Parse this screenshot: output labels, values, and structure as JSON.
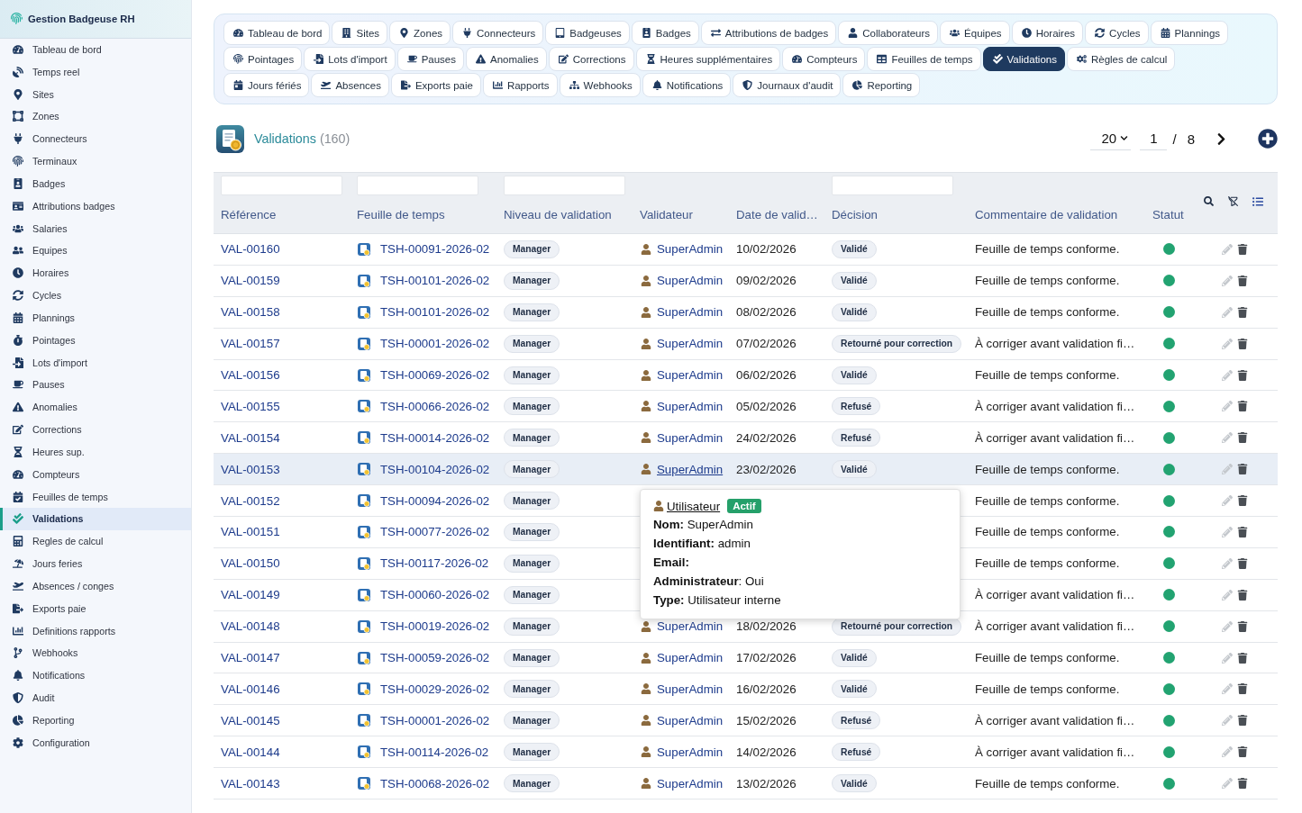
{
  "sidebar": {
    "title": "Gestion Badgeuse RH",
    "items": [
      {
        "label": "Tableau de bord",
        "selected": false
      },
      {
        "label": "Temps reel",
        "selected": false
      },
      {
        "label": "Sites",
        "selected": false
      },
      {
        "label": "Zones",
        "selected": false
      },
      {
        "label": "Connecteurs",
        "selected": false
      },
      {
        "label": "Terminaux",
        "selected": false
      },
      {
        "label": "Badges",
        "selected": false
      },
      {
        "label": "Attributions badges",
        "selected": false
      },
      {
        "label": "Salaries",
        "selected": false
      },
      {
        "label": "Equipes",
        "selected": false
      },
      {
        "label": "Horaires",
        "selected": false
      },
      {
        "label": "Cycles",
        "selected": false
      },
      {
        "label": "Plannings",
        "selected": false
      },
      {
        "label": "Pointages",
        "selected": false
      },
      {
        "label": "Lots d'import",
        "selected": false
      },
      {
        "label": "Pauses",
        "selected": false
      },
      {
        "label": "Anomalies",
        "selected": false
      },
      {
        "label": "Corrections",
        "selected": false
      },
      {
        "label": "Heures sup.",
        "selected": false
      },
      {
        "label": "Compteurs",
        "selected": false
      },
      {
        "label": "Feuilles de temps",
        "selected": false
      },
      {
        "label": "Validations",
        "selected": true
      },
      {
        "label": "Regles de calcul",
        "selected": false
      },
      {
        "label": "Jours feries",
        "selected": false
      },
      {
        "label": "Absences / conges",
        "selected": false
      },
      {
        "label": "Exports paie",
        "selected": false
      },
      {
        "label": "Definitions rapports",
        "selected": false
      },
      {
        "label": "Webhooks",
        "selected": false
      },
      {
        "label": "Notifications",
        "selected": false
      },
      {
        "label": "Audit",
        "selected": false
      },
      {
        "label": "Reporting",
        "selected": false
      },
      {
        "label": "Configuration",
        "selected": false
      }
    ]
  },
  "nav": {
    "tabs": [
      {
        "label": "Tableau de bord",
        "selected": false
      },
      {
        "label": "Sites",
        "selected": false
      },
      {
        "label": "Zones",
        "selected": false
      },
      {
        "label": "Connecteurs",
        "selected": false
      },
      {
        "label": "Badgeuses",
        "selected": false
      },
      {
        "label": "Badges",
        "selected": false
      },
      {
        "label": "Attributions de badges",
        "selected": false
      },
      {
        "label": "Collaborateurs",
        "selected": false
      },
      {
        "label": "Équipes",
        "selected": false
      },
      {
        "label": "Horaires",
        "selected": false
      },
      {
        "label": "Cycles",
        "selected": false
      },
      {
        "label": "Plannings",
        "selected": false
      },
      {
        "label": "Pointages",
        "selected": false
      },
      {
        "label": "Lots d'import",
        "selected": false
      },
      {
        "label": "Pauses",
        "selected": false
      },
      {
        "label": "Anomalies",
        "selected": false
      },
      {
        "label": "Corrections",
        "selected": false
      },
      {
        "label": "Heures supplémentaires",
        "selected": false
      },
      {
        "label": "Compteurs",
        "selected": false
      },
      {
        "label": "Feuilles de temps",
        "selected": false
      },
      {
        "label": "Validations",
        "selected": true
      },
      {
        "label": "Règles de calcul",
        "selected": false
      },
      {
        "label": "Jours fériés",
        "selected": false
      },
      {
        "label": "Absences",
        "selected": false
      },
      {
        "label": "Exports paie",
        "selected": false
      },
      {
        "label": "Rapports",
        "selected": false
      },
      {
        "label": "Webhooks",
        "selected": false
      },
      {
        "label": "Notifications",
        "selected": false
      },
      {
        "label": "Journaux d'audit",
        "selected": false
      },
      {
        "label": "Reporting",
        "selected": false
      }
    ]
  },
  "header": {
    "title": "Validations",
    "count": "(160)",
    "pagination": {
      "page_size": "20",
      "page": "1",
      "separator": "/",
      "total_pages": "8"
    }
  },
  "table": {
    "columns": [
      {
        "label": "Référence",
        "filter": true
      },
      {
        "label": "Feuille de temps",
        "filter": true
      },
      {
        "label": "Niveau de validation",
        "filter": true
      },
      {
        "label": "Validateur",
        "filter": false
      },
      {
        "label": "Date de valid…",
        "filter": false
      },
      {
        "label": "Décision",
        "filter": true
      },
      {
        "label": "Commentaire de validation",
        "filter": false
      },
      {
        "label": "Statut",
        "filter": false
      }
    ],
    "rows": [
      {
        "reference": "VAL-00160",
        "timesheet": "TSH-00091-2026-02",
        "validation_level": "Manager",
        "validator": "SuperAdmin",
        "date": "10/02/2026",
        "decision": "Validé",
        "comment": "Feuille de temps conforme.",
        "active": true,
        "highlighted": false
      },
      {
        "reference": "VAL-00159",
        "timesheet": "TSH-00101-2026-02",
        "validation_level": "Manager",
        "validator": "SuperAdmin",
        "date": "09/02/2026",
        "decision": "Validé",
        "comment": "Feuille de temps conforme.",
        "active": true,
        "highlighted": false
      },
      {
        "reference": "VAL-00158",
        "timesheet": "TSH-00101-2026-02",
        "validation_level": "Manager",
        "validator": "SuperAdmin",
        "date": "08/02/2026",
        "decision": "Validé",
        "comment": "Feuille de temps conforme.",
        "active": true,
        "highlighted": false
      },
      {
        "reference": "VAL-00157",
        "timesheet": "TSH-00001-2026-02",
        "validation_level": "Manager",
        "validator": "SuperAdmin",
        "date": "07/02/2026",
        "decision": "Retourné pour correction",
        "comment": "À corriger avant validation fi…",
        "active": true,
        "highlighted": false
      },
      {
        "reference": "VAL-00156",
        "timesheet": "TSH-00069-2026-02",
        "validation_level": "Manager",
        "validator": "SuperAdmin",
        "date": "06/02/2026",
        "decision": "Validé",
        "comment": "Feuille de temps conforme.",
        "active": true,
        "highlighted": false
      },
      {
        "reference": "VAL-00155",
        "timesheet": "TSH-00066-2026-02",
        "validation_level": "Manager",
        "validator": "SuperAdmin",
        "date": "05/02/2026",
        "decision": "Refusé",
        "comment": "À corriger avant validation fi…",
        "active": true,
        "highlighted": false
      },
      {
        "reference": "VAL-00154",
        "timesheet": "TSH-00014-2026-02",
        "validation_level": "Manager",
        "validator": "SuperAdmin",
        "date": "24/02/2026",
        "decision": "Refusé",
        "comment": "À corriger avant validation fi…",
        "active": true,
        "highlighted": false
      },
      {
        "reference": "VAL-00153",
        "timesheet": "TSH-00104-2026-02",
        "validation_level": "Manager",
        "validator": "SuperAdmin",
        "date": "23/02/2026",
        "decision": "Validé",
        "comment": "Feuille de temps conforme.",
        "active": true,
        "highlighted": true
      },
      {
        "reference": "VAL-00152",
        "timesheet": "TSH-00094-2026-02",
        "validation_level": "Manager",
        "comment": "Feuille de temps conforme.",
        "active": true,
        "highlighted": false
      },
      {
        "reference": "VAL-00151",
        "timesheet": "TSH-00077-2026-02",
        "validation_level": "Manager",
        "comment": "Feuille de temps conforme.",
        "active": true,
        "highlighted": false
      },
      {
        "reference": "VAL-00150",
        "timesheet": "TSH-00117-2026-02",
        "validation_level": "Manager",
        "comment": "Feuille de temps conforme.",
        "active": true,
        "highlighted": false
      },
      {
        "reference": "VAL-00149",
        "timesheet": "TSH-00060-2026-02",
        "validation_level": "Manager",
        "comment": "À corriger avant validation fi…",
        "active": true,
        "highlighted": false
      },
      {
        "reference": "VAL-00148",
        "timesheet": "TSH-00019-2026-02",
        "validation_level": "Manager",
        "validator": "SuperAdmin",
        "date": "18/02/2026",
        "decision": "Retourné pour correction",
        "comment": "À corriger avant validation fi…",
        "active": true,
        "highlighted": false
      },
      {
        "reference": "VAL-00147",
        "timesheet": "TSH-00059-2026-02",
        "validation_level": "Manager",
        "validator": "SuperAdmin",
        "date": "17/02/2026",
        "decision": "Validé",
        "comment": "Feuille de temps conforme.",
        "active": true,
        "highlighted": false
      },
      {
        "reference": "VAL-00146",
        "timesheet": "TSH-00029-2026-02",
        "validation_level": "Manager",
        "validator": "SuperAdmin",
        "date": "16/02/2026",
        "decision": "Validé",
        "comment": "Feuille de temps conforme.",
        "active": true,
        "highlighted": false
      },
      {
        "reference": "VAL-00145",
        "timesheet": "TSH-00001-2026-02",
        "validation_level": "Manager",
        "validator": "SuperAdmin",
        "date": "15/02/2026",
        "decision": "Refusé",
        "comment": "À corriger avant validation fi…",
        "active": true,
        "highlighted": false
      },
      {
        "reference": "VAL-00144",
        "timesheet": "TSH-00114-2026-02",
        "validation_level": "Manager",
        "validator": "SuperAdmin",
        "date": "14/02/2026",
        "decision": "Refusé",
        "comment": "À corriger avant validation fi…",
        "active": true,
        "highlighted": false
      },
      {
        "reference": "VAL-00143",
        "timesheet": "TSH-00068-2026-02",
        "validation_level": "Manager",
        "validator": "SuperAdmin",
        "date": "13/02/2026",
        "decision": "Validé",
        "comment": "Feuille de temps conforme.",
        "active": true,
        "highlighted": false
      }
    ]
  },
  "tooltip": {
    "title": "Utilisateur",
    "badge": "Actif",
    "lines": [
      "**Nom:** SuperAdmin",
      "**Identifiant:** admin",
      "**Email:**",
      "**Administrateur**: Oui",
      "**Type:** Utilisateur interne"
    ]
  }
}
